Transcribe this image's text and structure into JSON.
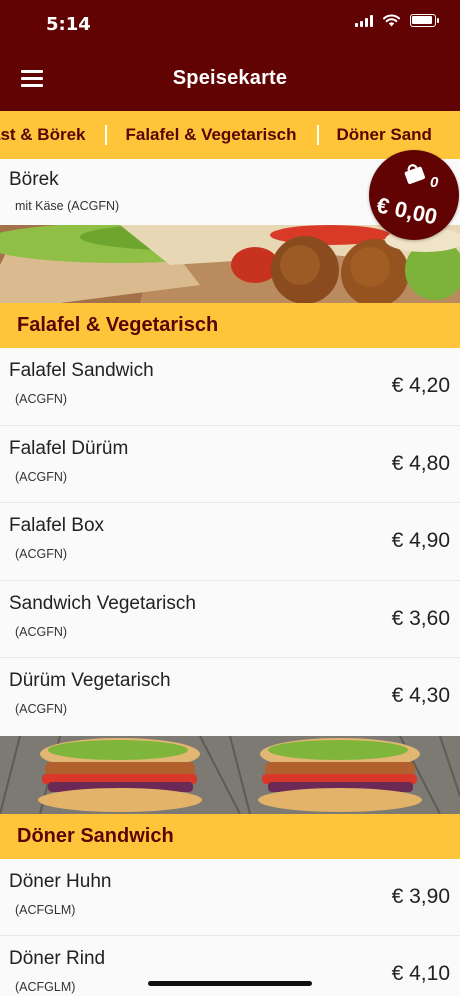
{
  "status_bar": {
    "time": "5:14"
  },
  "header": {
    "title": "Speisekarte"
  },
  "tabs": [
    {
      "label": "ast & Börek"
    },
    {
      "label": "Falafel & Vegetarisch"
    },
    {
      "label": "Döner Sand"
    }
  ],
  "top_item": {
    "name": "Börek",
    "desc": "mit Käse (ACGFN)"
  },
  "cart": {
    "count": "0",
    "total": "€ 0,00"
  },
  "sections": [
    {
      "title": "Falafel & Vegetarisch",
      "items": [
        {
          "name": "Falafel Sandwich",
          "desc": "(ACGFN)",
          "price": "€ 4,20"
        },
        {
          "name": "Falafel Dürüm",
          "desc": "(ACGFN)",
          "price": "€ 4,80"
        },
        {
          "name": "Falafel Box",
          "desc": "(ACGFN)",
          "price": "€ 4,90"
        },
        {
          "name": "Sandwich Vegetarisch",
          "desc": "(ACGFN)",
          "price": "€ 3,60"
        },
        {
          "name": "Dürüm Vegetarisch",
          "desc": "(ACGFN)",
          "price": "€ 4,30"
        }
      ]
    },
    {
      "title": "Döner Sandwich",
      "items": [
        {
          "name": "Döner Huhn",
          "desc": "(ACFGLM)",
          "price": "€ 3,90"
        },
        {
          "name": "Döner Rind",
          "desc": "(ACFGLM)",
          "price": "€ 4,10"
        }
      ]
    }
  ],
  "colors": {
    "brand": "#600302",
    "accent": "#fec53a",
    "accent_text": "#5a0404"
  },
  "icons": {
    "menu": "hamburger-icon",
    "cart": "shopping-bag-icon"
  }
}
